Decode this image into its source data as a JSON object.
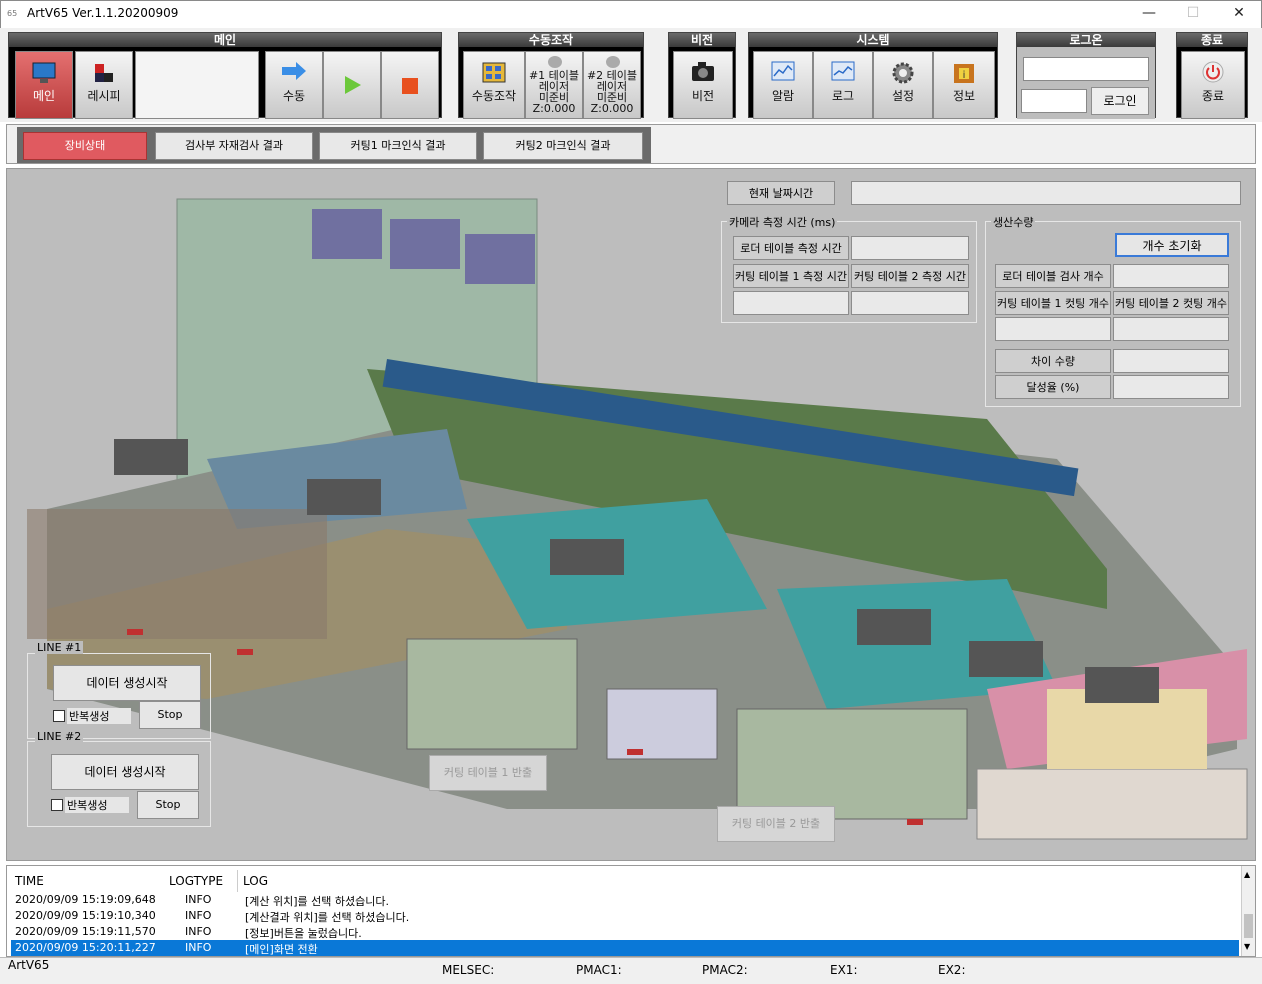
{
  "window": {
    "title": "ArtV65 Ver.1.1.20200909",
    "app_icon": "65"
  },
  "toolbar": {
    "groups": {
      "main": "메인",
      "manual": "수동조작",
      "vision": "비전",
      "system": "시스템",
      "login": "로그온",
      "exit": "종료"
    },
    "main_btn": "메인",
    "recipe_btn": "레시피",
    "manual_btn": "수동",
    "manual_op_btn": "수동조작",
    "table1": {
      "l1": "#1 테이블",
      "l2": "레이저",
      "l3": "미준비",
      "l4": "Z:0.000"
    },
    "table2": {
      "l1": "#2 테이블",
      "l2": "레이저",
      "l3": "미준비",
      "l4": "Z:0.000"
    },
    "vision_btn": "비전",
    "alarm_btn": "알람",
    "log_btn": "로그",
    "settings_btn": "설정",
    "info_btn": "정보",
    "login_btn": "로그인",
    "exit_btn": "종료"
  },
  "tabs": [
    "장비상태",
    "검사부 자재검사 결과",
    "커팅1 마크인식 결과",
    "커팅2 마크인식 결과"
  ],
  "panel": {
    "datetime_label": "현재 날짜시간",
    "camera_group": "카메라 측정 시간 (ms)",
    "loader_time": "로더 테이블 측정 시간",
    "cut1_time": "커팅 테이블 1 측정 시간",
    "cut2_time": "커팅 테이블 2 측정 시간",
    "prod_group": "생산수량",
    "reset_btn": "개수 초기화",
    "loader_count": "로더 테이블 검사 개수",
    "cut1_count": "커팅 테이블 1 컷팅 개수",
    "cut2_count": "커팅 테이블 2 컷팅 개수",
    "diff": "차이 수량",
    "achieve": "달성율 (%)"
  },
  "lines": [
    {
      "title": "LINE #1",
      "start": "데이터 생성시작",
      "repeat": "반복생성",
      "stop": "Stop"
    },
    {
      "title": "LINE #2",
      "start": "데이터 생성시작",
      "repeat": "반복생성",
      "stop": "Stop"
    }
  ],
  "return_btns": [
    "커팅 테이블 1 반출",
    "커팅 테이블 2 반출"
  ],
  "log": {
    "headers": [
      "TIME",
      "LOGTYPE",
      "LOG"
    ],
    "rows": [
      {
        "time": "2020/09/09 15:19:09,648",
        "type": "INFO",
        "msg": "[계산 위치]를 선택 하셨습니다."
      },
      {
        "time": "2020/09/09 15:19:10,340",
        "type": "INFO",
        "msg": "[계산결과 위치]를 선택 하셨습니다."
      },
      {
        "time": "2020/09/09 15:19:11,570",
        "type": "INFO",
        "msg": "[정보]버튼을 눌렀습니다."
      },
      {
        "time": "2020/09/09 15:20:11,227",
        "type": "INFO",
        "msg": "[메인]화면 전환"
      }
    ]
  },
  "status": {
    "app": "ArtV65",
    "melsec": "MELSEC:",
    "pmac1": "PMAC1:",
    "pmac2": "PMAC2:",
    "ex1": "EX1:",
    "ex2": "EX2:"
  }
}
